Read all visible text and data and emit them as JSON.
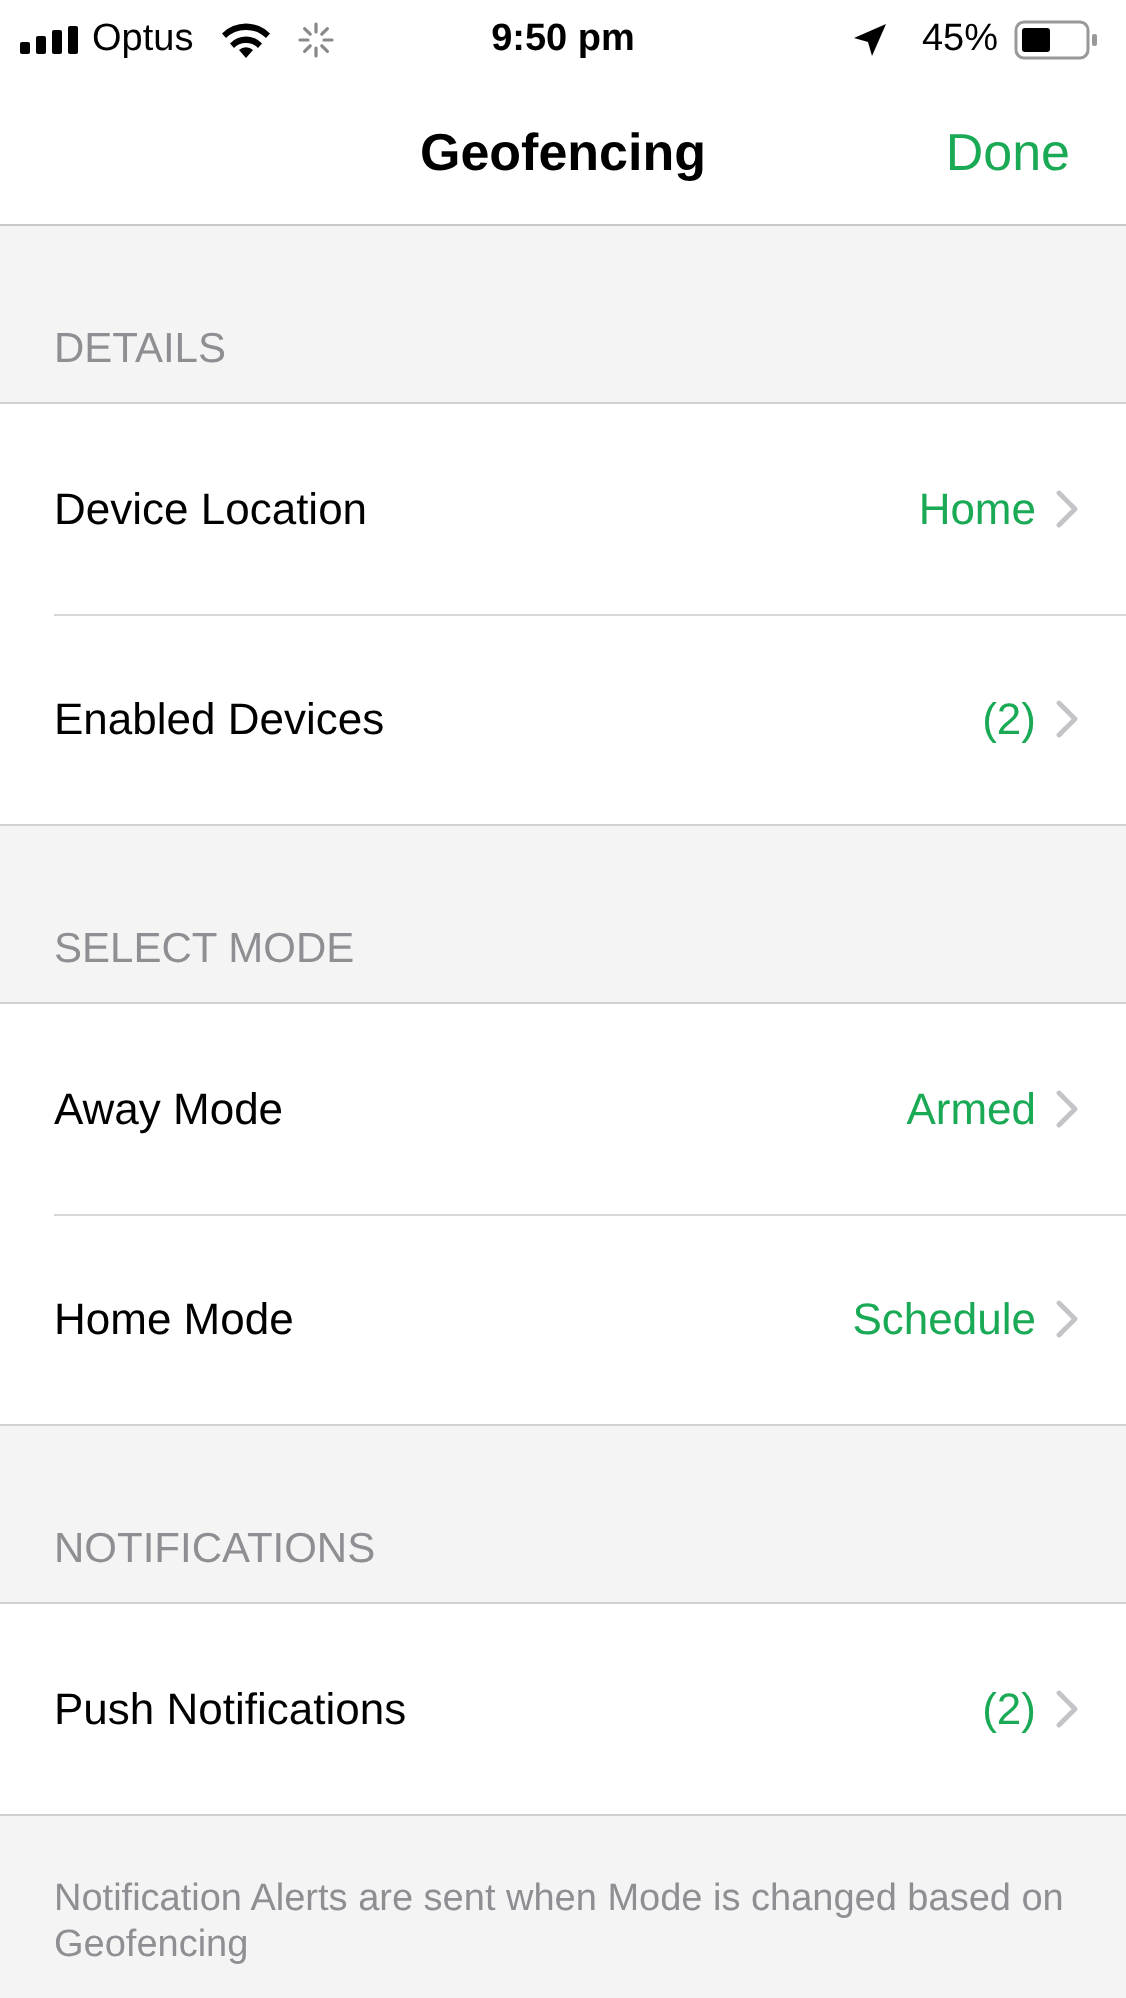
{
  "status_bar": {
    "carrier": "Optus",
    "time": "9:50 pm",
    "battery": "45%"
  },
  "nav": {
    "title": "Geofencing",
    "action": "Done"
  },
  "sections": [
    {
      "header": "DETAILS",
      "rows": [
        {
          "label": "Device Location",
          "value": "Home"
        },
        {
          "label": "Enabled Devices",
          "value": "(2)"
        }
      ]
    },
    {
      "header": "SELECT MODE",
      "rows": [
        {
          "label": "Away Mode",
          "value": "Armed"
        },
        {
          "label": "Home Mode",
          "value": "Schedule"
        }
      ]
    },
    {
      "header": "NOTIFICATIONS",
      "rows": [
        {
          "label": "Push Notifications",
          "value": "(2)"
        }
      ]
    }
  ],
  "footer": "Notification Alerts are sent when Mode is changed based on Geofencing"
}
